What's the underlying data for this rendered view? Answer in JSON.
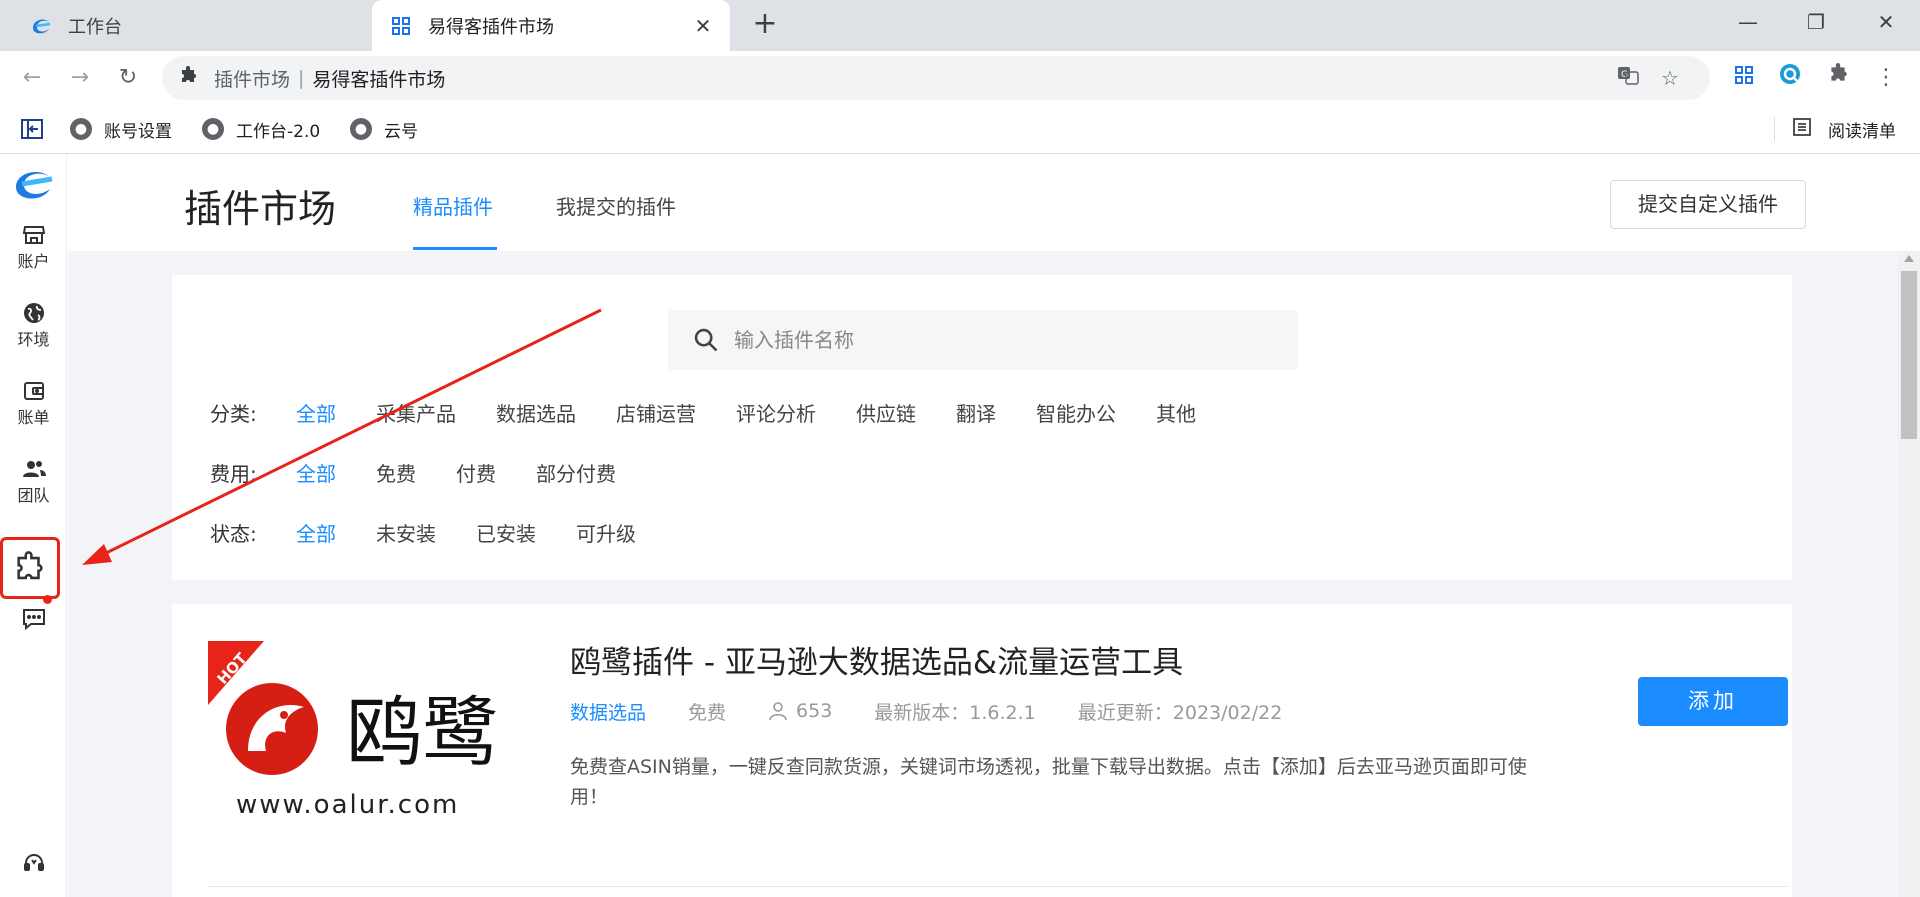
{
  "browser": {
    "tabs": [
      {
        "title": "工作台",
        "active": false
      },
      {
        "title": "易得客插件市场",
        "active": true
      }
    ],
    "omnibox": {
      "host": "插件市场",
      "title": "易得客插件市场"
    },
    "bookmarks": [
      {
        "label": "账号设置"
      },
      {
        "label": "工作台-2.0"
      },
      {
        "label": "云号"
      }
    ],
    "reading_list": "阅读清单"
  },
  "sidebar": {
    "items": [
      {
        "label": "账户",
        "icon": "store-icon"
      },
      {
        "label": "环境",
        "icon": "globe-icon"
      },
      {
        "label": "账单",
        "icon": "wallet-icon"
      },
      {
        "label": "团队",
        "icon": "team-icon"
      }
    ],
    "highlight_color": "#e8231a"
  },
  "header": {
    "title": "插件市场",
    "tabs": [
      {
        "label": "精品插件",
        "active": true
      },
      {
        "label": "我提交的插件",
        "active": false
      }
    ],
    "submit_button": "提交自定义插件"
  },
  "search": {
    "placeholder": "输入插件名称"
  },
  "filters": {
    "category": {
      "label": "分类:",
      "options": [
        "全部",
        "采集产品",
        "数据选品",
        "店铺运营",
        "评论分析",
        "供应链",
        "翻译",
        "智能办公",
        "其他"
      ],
      "selected": "全部"
    },
    "fee": {
      "label": "费用:",
      "options": [
        "全部",
        "免费",
        "付费",
        "部分付费"
      ],
      "selected": "全部"
    },
    "status": {
      "label": "状态:",
      "options": [
        "全部",
        "未安装",
        "已安装",
        "可升级"
      ],
      "selected": "全部"
    }
  },
  "plugins": [
    {
      "name": "鸥鹭插件 - 亚马逊大数据选品&流量运营工具",
      "category": "数据选品",
      "fee": "免费",
      "users": "653",
      "version": "最新版本：1.6.2.1",
      "updated": "最近更新：2023/02/22",
      "description": "免费查ASIN销量，一键反查同款货源，关键词市场透视，批量下载导出数据。点击【添加】后去亚马逊页面即可使用！",
      "add_label": "添加",
      "logo": {
        "badge": "HOT",
        "brand": "鸥鹭",
        "site": "www.oalur.com"
      }
    }
  ],
  "colors": {
    "accent": "#1a8cff",
    "annotation": "#e8231a"
  }
}
